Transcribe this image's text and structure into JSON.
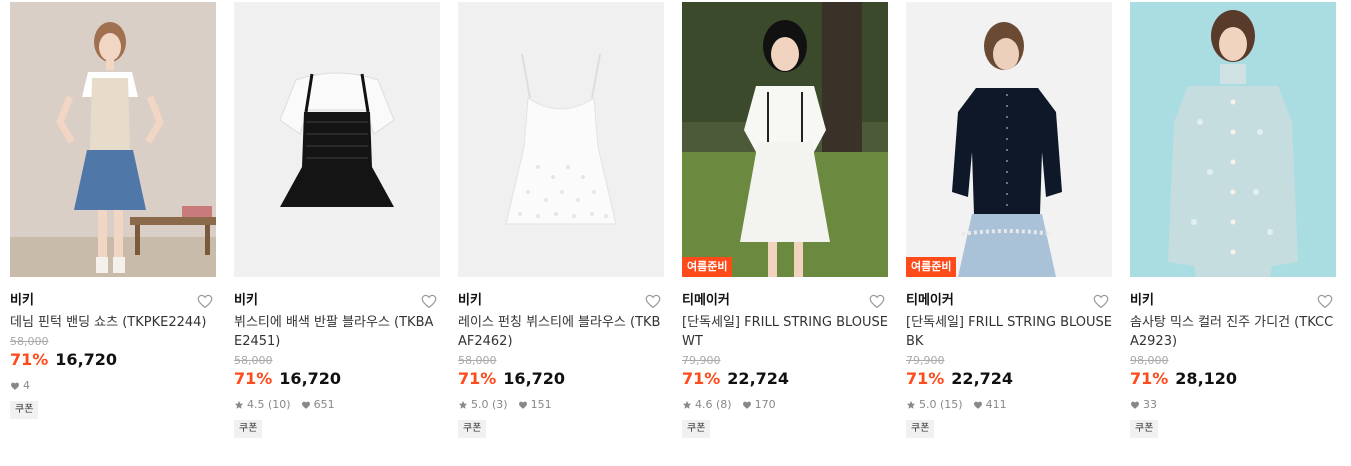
{
  "products": [
    {
      "brand": "비키",
      "name": "데님 핀턱 밴딩 쇼츠 (TKPKE2244)",
      "original_price": "58,000",
      "discount": "71%",
      "price": "16,720",
      "rating": "",
      "likes": "4",
      "coupon": "쿠폰",
      "tag": "",
      "image": "model-denim-shorts-knit-vest"
    },
    {
      "brand": "비키",
      "name": "뷔스티에 배색 반팔 블라우스 (TKBAE2451)",
      "original_price": "58,000",
      "discount": "71%",
      "price": "16,720",
      "rating": "4.5 (10)",
      "likes": "651",
      "coupon": "쿠폰",
      "tag": "",
      "image": "black-bustier-white-blouse"
    },
    {
      "brand": "비키",
      "name": "레이스 펀칭 뷔스티에 블라우스 (TKBAF2462)",
      "original_price": "58,000",
      "discount": "71%",
      "price": "16,720",
      "rating": "5.0 (3)",
      "likes": "151",
      "coupon": "쿠폰",
      "tag": "",
      "image": "white-lace-bustier-blouse"
    },
    {
      "brand": "티메이커",
      "name": "[단독세일] FRILL STRING BLOUSE WT",
      "original_price": "79,900",
      "discount": "71%",
      "price": "22,724",
      "rating": "4.6 (8)",
      "likes": "170",
      "coupon": "쿠폰",
      "tag": "여름준비",
      "image": "model-white-frill-blouse-outdoor"
    },
    {
      "brand": "티메이커",
      "name": "[단독세일] FRILL STRING BLOUSE BK",
      "original_price": "79,900",
      "discount": "71%",
      "price": "22,724",
      "rating": "5.0 (15)",
      "likes": "411",
      "coupon": "쿠폰",
      "tag": "여름준비",
      "image": "model-black-frill-blouse"
    },
    {
      "brand": "비키",
      "name": "솜사탕 믹스 컬러 진주 가디건 (TKCCA2923)",
      "original_price": "98,000",
      "discount": "71%",
      "price": "28,120",
      "rating": "",
      "likes": "33",
      "coupon": "쿠폰",
      "tag": "",
      "image": "model-mint-pearl-cardigan"
    }
  ],
  "icons": {
    "wish": "heart-outline-icon",
    "rating": "star-icon",
    "likes": "heart-filled-icon"
  },
  "colors": {
    "discount": "#ff4a1a",
    "tag_bg": "#ff4a1a"
  }
}
